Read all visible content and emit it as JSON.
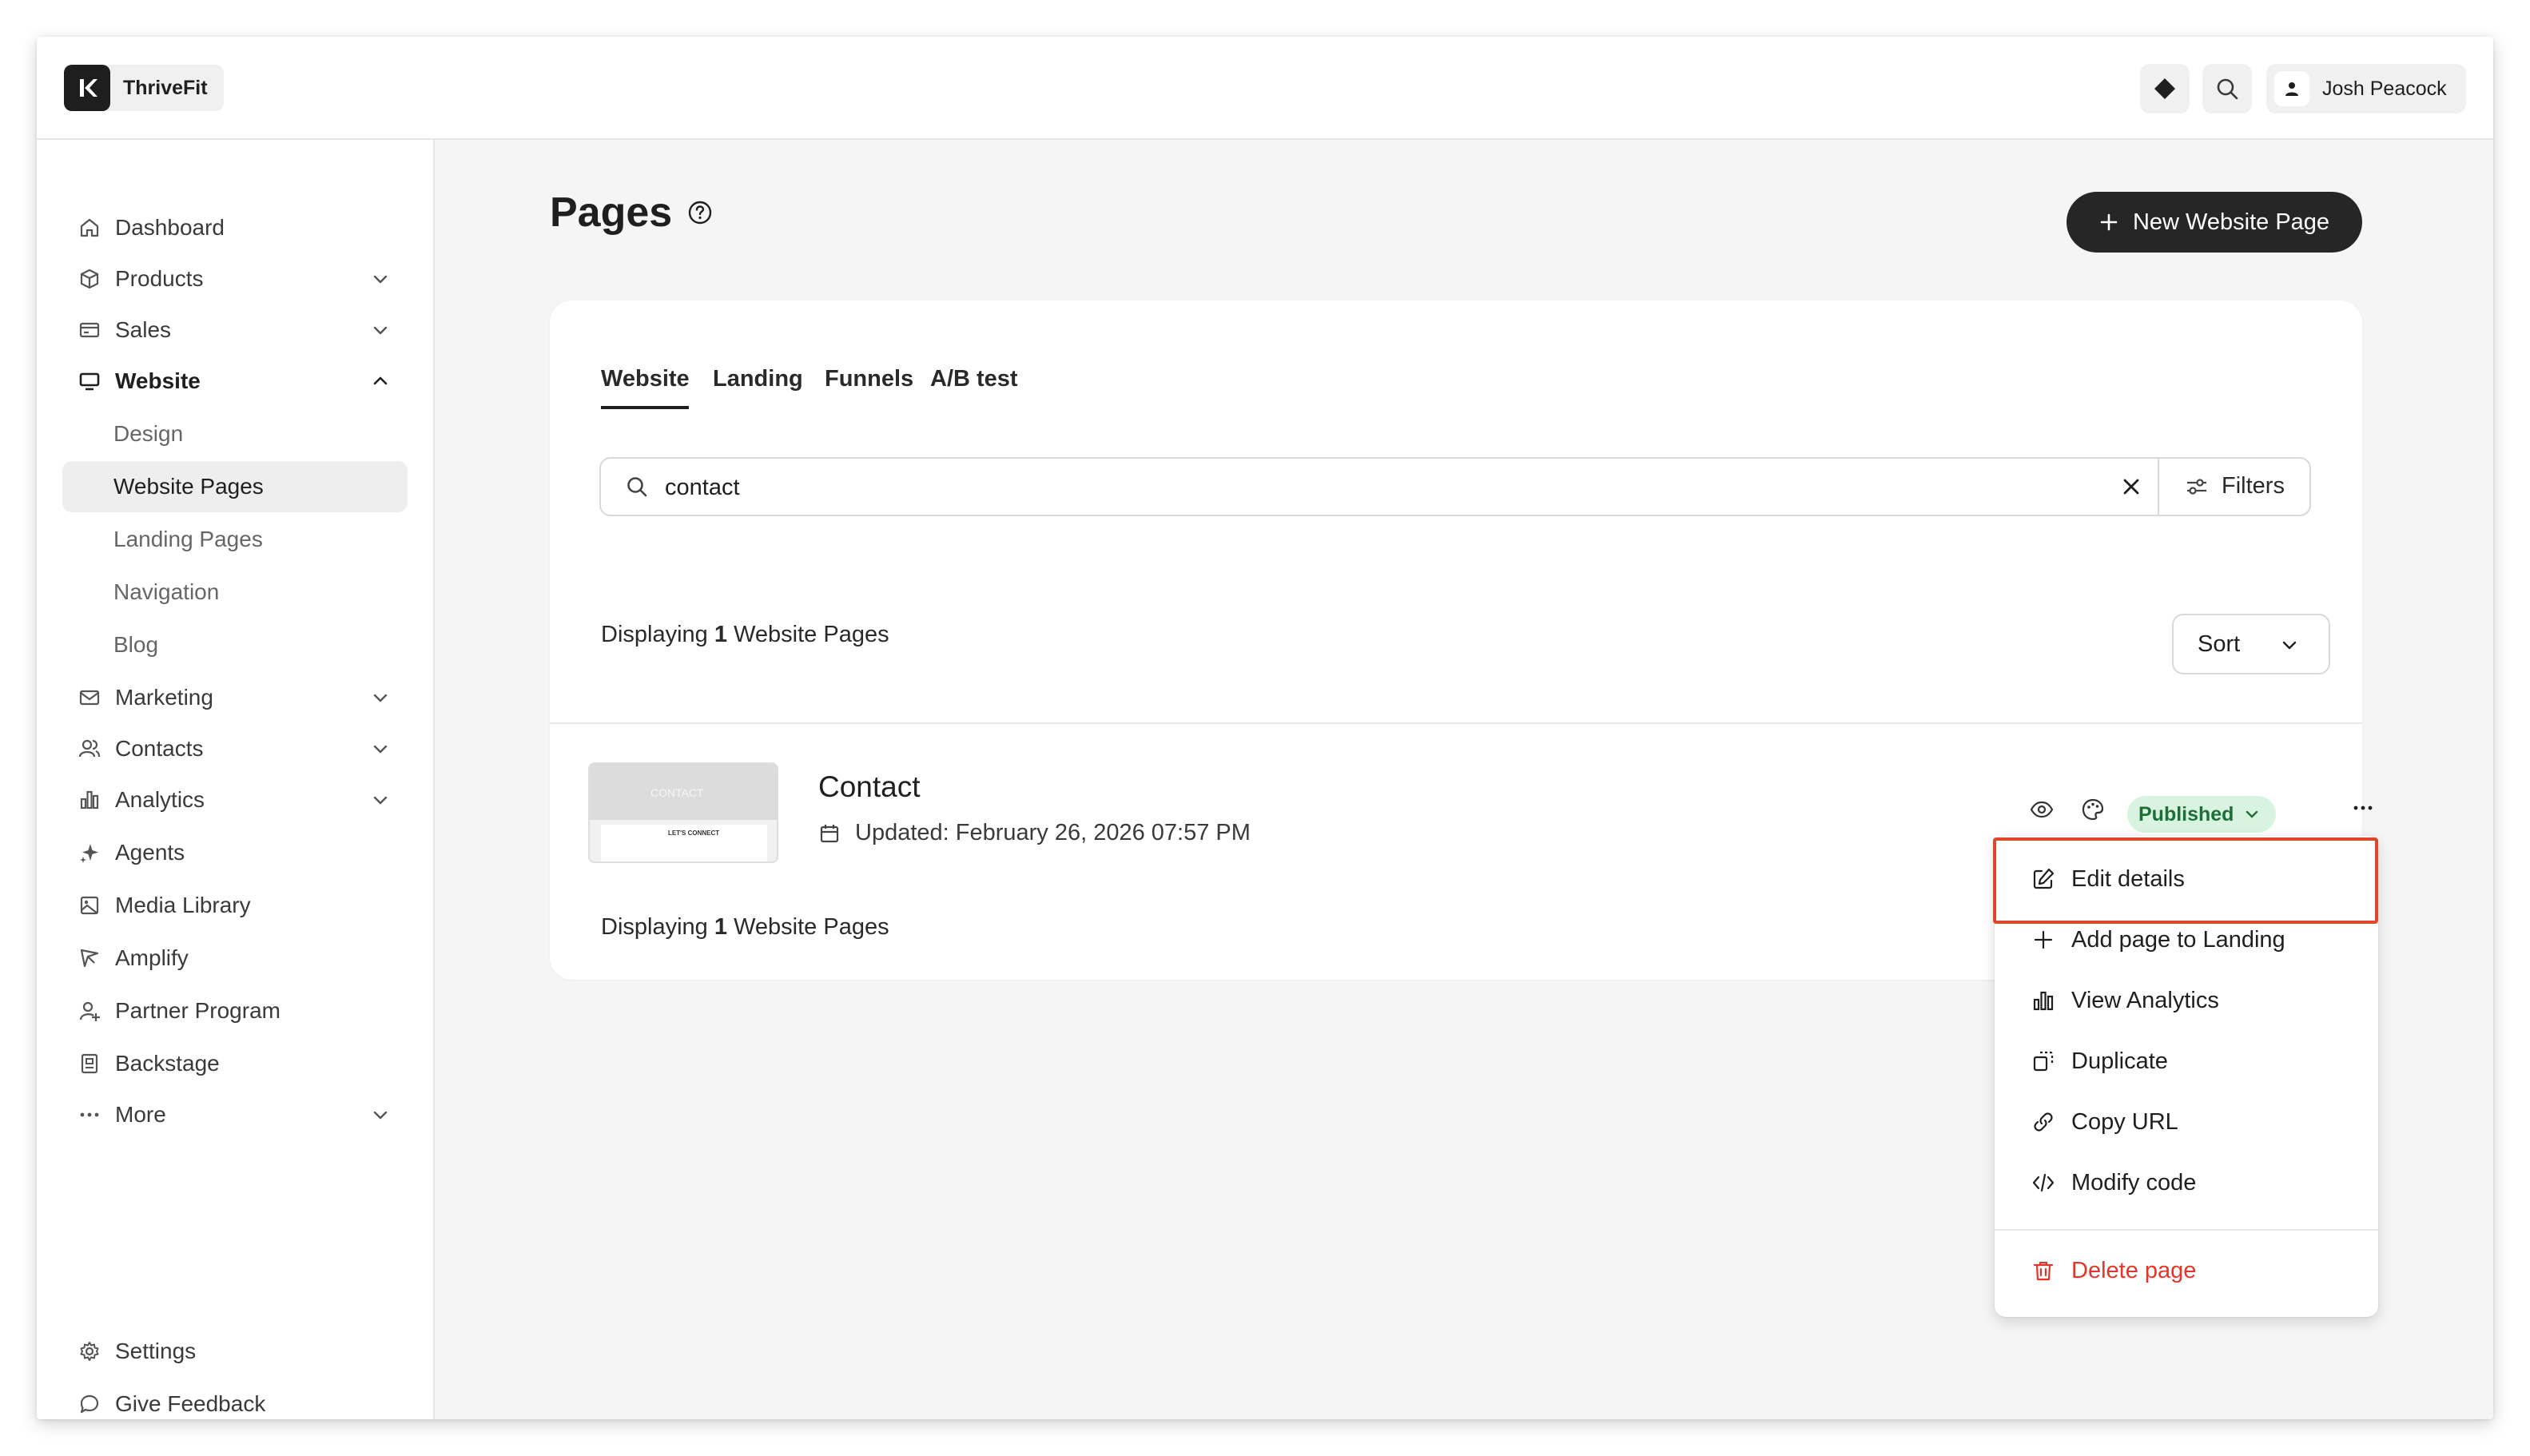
{
  "app": {
    "name": "ThriveFit"
  },
  "user": {
    "name": "Josh Peacock"
  },
  "sidebar": {
    "items": [
      {
        "label": "Dashboard"
      },
      {
        "label": "Products"
      },
      {
        "label": "Sales"
      },
      {
        "label": "Website"
      },
      {
        "label": "Marketing"
      },
      {
        "label": "Contacts"
      },
      {
        "label": "Analytics"
      },
      {
        "label": "Agents"
      },
      {
        "label": "Media Library"
      },
      {
        "label": "Amplify"
      },
      {
        "label": "Partner Program"
      },
      {
        "label": "Backstage"
      },
      {
        "label": "More"
      }
    ],
    "website_subitems": [
      {
        "label": "Design"
      },
      {
        "label": "Website Pages"
      },
      {
        "label": "Landing Pages"
      },
      {
        "label": "Navigation"
      },
      {
        "label": "Blog"
      }
    ],
    "footer": [
      {
        "label": "Settings"
      },
      {
        "label": "Give Feedback"
      }
    ]
  },
  "main": {
    "title": "Pages",
    "new_button": "New Website Page",
    "tabs": [
      {
        "label": "Website"
      },
      {
        "label": "Landing"
      },
      {
        "label": "Funnels"
      },
      {
        "label": "A/B test"
      }
    ],
    "search": {
      "value": "contact",
      "placeholder": ""
    },
    "filters_label": "Filters",
    "sort_label": "Sort",
    "count": {
      "prefix": "Displaying",
      "number": "1",
      "suffix": "Website Pages"
    },
    "item": {
      "title": "Contact",
      "updated": "Updated: February 26, 2026 07:57 PM",
      "status": "Published",
      "thumb_heading": "CONTACT",
      "thumb_text": "LET'S CONNECT"
    }
  },
  "menu": {
    "items": [
      {
        "label": "Edit details"
      },
      {
        "label": "Add page to Landing"
      },
      {
        "label": "View Analytics"
      },
      {
        "label": "Duplicate"
      },
      {
        "label": "Copy URL"
      },
      {
        "label": "Modify code"
      }
    ],
    "delete_label": "Delete page"
  },
  "colors": {
    "accent": "#262626",
    "published_bg": "#d8f4e1",
    "published_text": "#1f6e3a",
    "danger": "#e5342a",
    "highlight": "#e0462d"
  },
  "icons": {
    "brand": "k-logo-icon",
    "top": [
      "diamond-icon",
      "search-icon",
      "user-icon"
    ],
    "sidebar": [
      "home-icon",
      "box-icon",
      "card-icon",
      "monitor-icon",
      "mail-icon",
      "users-icon",
      "bar-chart-icon",
      "sparkle-icon",
      "image-icon",
      "megaphone-icon",
      "partner-icon",
      "badge-icon",
      "dots-icon",
      "gear-icon",
      "chat-icon"
    ],
    "menu": [
      "edit-icon",
      "plus-icon",
      "bar-chart-icon",
      "duplicate-icon",
      "link-icon",
      "code-icon",
      "trash-icon"
    ]
  }
}
